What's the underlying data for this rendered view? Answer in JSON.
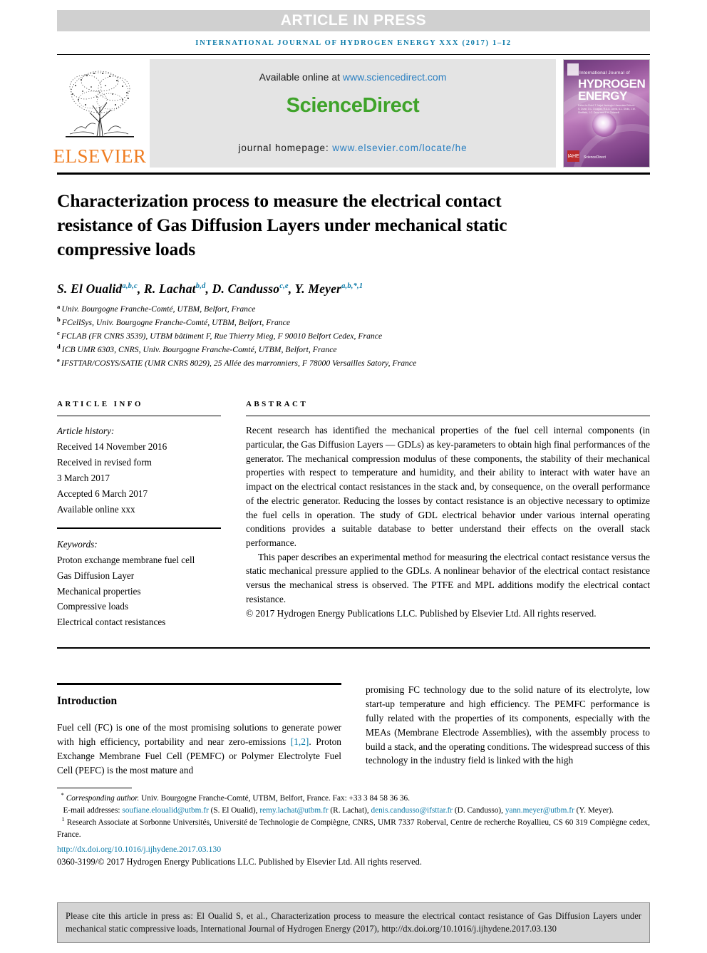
{
  "banner": {
    "article_in_press": "ARTICLE IN PRESS",
    "running_head": "INTERNATIONAL JOURNAL OF HYDROGEN ENERGY XXX (2017) 1–I2"
  },
  "masthead": {
    "publisher_name": "ELSEVIER",
    "available_online_label": "Available online at ",
    "available_online_url": "www.sciencedirect.com",
    "wordmark": "ScienceDirect",
    "homepage_label": "journal homepage: ",
    "homepage_url": "www.elsevier.com/locate/he",
    "cover": {
      "line1": "International Journal of",
      "line2": "HYDROGEN",
      "line3": "ENERGY",
      "editors": "Editor-in-Chief: T. Nejat Veziroglu / Associate Editors: S. Dunn, D.L. Douglas, R.A.A. Jarvis, A.L. Dicks, J.W. Sheffield, J.C. Dunn and E.A. Ticianelli",
      "sciencedirect_mark": "ScienceDirect",
      "badge": "IAHE"
    }
  },
  "article": {
    "title": "Characterization process to measure the electrical contact resistance of Gas Diffusion Layers under mechanical static compressive loads",
    "authors": [
      {
        "name": "S. El Oualid",
        "marks": "a,b,c",
        "sep": ", "
      },
      {
        "name": "R. Lachat",
        "marks": "b,d",
        "sep": ", "
      },
      {
        "name": "D. Candusso",
        "marks": "c,e",
        "sep": ", "
      },
      {
        "name": "Y. Meyer",
        "marks": "a,b,*,1",
        "sep": ""
      }
    ],
    "affiliations": [
      {
        "mark": "a",
        "text": "Univ. Bourgogne Franche-Comté, UTBM, Belfort, France"
      },
      {
        "mark": "b",
        "text": "FCellSys, Univ. Bourgogne Franche-Comté, UTBM, Belfort, France"
      },
      {
        "mark": "c",
        "text": "FCLAB (FR CNRS 3539), UTBM bâtiment F, Rue Thierry Mieg, F 90010 Belfort Cedex, France"
      },
      {
        "mark": "d",
        "text": "ICB UMR 6303, CNRS, Univ. Bourgogne Franche-Comté, UTBM, Belfort, France"
      },
      {
        "mark": "e",
        "text": "IFSTTAR/COSYS/SATIE (UMR CNRS 8029), 25 Allée des marronniers, F 78000 Versailles Satory, France"
      }
    ]
  },
  "article_info": {
    "heading": "ARTICLE INFO",
    "history_label": "Article history:",
    "history": [
      "Received 14 November 2016",
      "Received in revised form",
      "3 March 2017",
      "Accepted 6 March 2017",
      "Available online xxx"
    ],
    "keywords_label": "Keywords:",
    "keywords": [
      "Proton exchange membrane fuel cell",
      "Gas Diffusion Layer",
      "Mechanical properties",
      "Compressive loads",
      "Electrical contact resistances"
    ]
  },
  "abstract": {
    "heading": "ABSTRACT",
    "paragraphs": [
      "Recent research has identified the mechanical properties of the fuel cell internal components (in particular, the Gas Diffusion Layers — GDLs) as key-parameters to obtain high final performances of the generator. The mechanical compression modulus of these components, the stability of their mechanical properties with respect to temperature and humidity, and their ability to interact with water have an impact on the electrical contact resistances in the stack and, by consequence, on the overall performance of the electric generator. Reducing the losses by contact resistance is an objective necessary to optimize the fuel cells in operation. The study of GDL electrical behavior under various internal operating conditions provides a suitable database to better understand their effects on the overall stack performance.",
      "This paper describes an experimental method for measuring the electrical contact resistance versus the static mechanical pressure applied to the GDLs. A nonlinear behavior of the electrical contact resistance versus the mechanical stress is observed. The PTFE and MPL additions modify the electrical contact resistance."
    ],
    "copyright": "© 2017 Hydrogen Energy Publications LLC. Published by Elsevier Ltd. All rights reserved."
  },
  "introduction": {
    "heading": "Introduction",
    "left_column": {
      "pre_ref": "Fuel cell (FC) is one of the most promising solutions to generate power with high efficiency, portability and near zero-emissions ",
      "ref": "[1,2]",
      "post_ref": ". Proton Exchange Membrane Fuel Cell (PEMFC) or Polymer Electrolyte Fuel Cell (PEFC) is the most mature and"
    },
    "right_column": "promising FC technology due to the solid nature of its electrolyte, low start-up temperature and high efficiency. The PEMFC performance is fully related with the properties of its components, especially with the MEAs (Membrane Electrode Assemblies), with the assembly process to build a stack, and the operating conditions. The widespread success of this technology in the industry field is linked with the high"
  },
  "footnotes": {
    "corresponding": {
      "mark": "*",
      "italic_label": "Corresponding author.",
      "text": " Univ. Bourgogne Franche-Comté, UTBM, Belfort, France. Fax: +33 3 84 58 36 36."
    },
    "emails": {
      "label": "E-mail addresses: ",
      "items": [
        {
          "email": "soufiane.eloualid@utbm.fr",
          "who": " (S. El Oualid), "
        },
        {
          "email": "remy.lachat@utbm.fr",
          "who": " (R. Lachat), "
        },
        {
          "email": "denis.candusso@ifsttar.fr",
          "who": " (D. Candusso), "
        },
        {
          "email": "yann.meyer@utbm.fr",
          "who": " (Y. Meyer)."
        }
      ]
    },
    "note1": {
      "mark": "1",
      "text": " Research Associate at Sorbonne Universités, Université de Technologie de Compiègne, CNRS, UMR 7337 Roberval, Centre de recherche Royallieu, CS 60 319 Compiègne cedex, France."
    },
    "doi": "http://dx.doi.org/10.1016/j.ijhydene.2017.03.130",
    "issn_line": "0360-3199/© 2017 Hydrogen Energy Publications LLC. Published by Elsevier Ltd. All rights reserved."
  },
  "citation_box": {
    "text": "Please cite this article in press as: El Oualid S, et al., Characterization process to measure the electrical contact resistance of Gas Diffusion Layers under mechanical static compressive loads, International Journal of Hydrogen Energy (2017), http://dx.doi.org/10.1016/j.ijhydene.2017.03.130"
  },
  "colors": {
    "accent_blue": "#0b7aa8",
    "link_blue": "#2a7fc1",
    "sciencedirect_green": "#3fa32a",
    "elsevier_orange": "#ef7d22",
    "banner_gray": "#d0d0d0",
    "sd_box_gray": "#e4e4e4",
    "cite_box_gray": "#d4d4d4"
  }
}
